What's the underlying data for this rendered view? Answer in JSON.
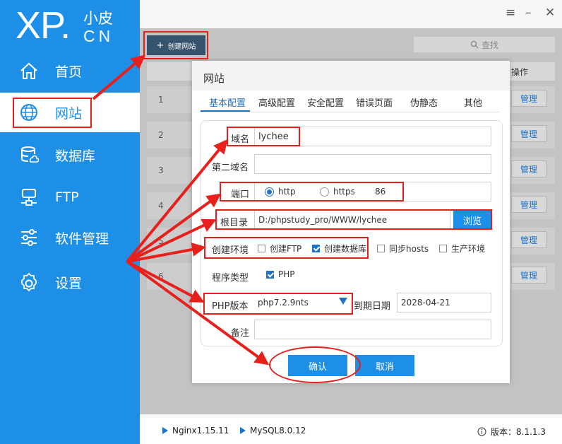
{
  "brand": {
    "xp": "XP.",
    "cn_top": "小皮",
    "cn_bottom": "CN"
  },
  "window_controls": {
    "menu": "≡",
    "minimize": "–",
    "close": "✕"
  },
  "sidebar": {
    "items": [
      {
        "label": "首页",
        "icon": "home-icon"
      },
      {
        "label": "网站",
        "icon": "globe-icon",
        "active": true
      },
      {
        "label": "数据库",
        "icon": "database-icon"
      },
      {
        "label": "FTP",
        "icon": "ftp-icon"
      },
      {
        "label": "软件管理",
        "icon": "sliders-icon"
      },
      {
        "label": "设置",
        "icon": "gear-icon"
      }
    ]
  },
  "toolbar": {
    "create_label": "创建网站",
    "search_placeholder": "查找"
  },
  "table": {
    "op_header": "操作",
    "rows": [
      {
        "num": "1",
        "action": "管理"
      },
      {
        "num": "2",
        "action": "管理"
      },
      {
        "num": "3",
        "action": "管理"
      },
      {
        "num": "4",
        "action": "管理"
      },
      {
        "num": "5",
        "action": "管理"
      },
      {
        "num": "6",
        "action": "管理"
      }
    ]
  },
  "dialog": {
    "title": "网站",
    "tabs": [
      "基本配置",
      "高级配置",
      "安全配置",
      "错误页面",
      "伪静态",
      "其他"
    ],
    "fields": {
      "domain_label": "域名",
      "domain_value": "lychee",
      "second_domain_label": "第二域名",
      "second_domain_value": "",
      "port_label": "端口",
      "http_label": "http",
      "https_label": "https",
      "port_value": "86",
      "root_label": "根目录",
      "root_value": "D:/phpstudy_pro/WWW/lychee",
      "browse_label": "浏览",
      "env_label": "创建环境",
      "env_ftp": "创建FTP",
      "env_db": "创建数据库",
      "env_hosts": "同步hosts",
      "env_prod": "生产环境",
      "program_label": "程序类型",
      "program_php": "PHP",
      "php_label": "PHP版本",
      "php_value": "php7.2.9nts",
      "expire_label": "到期日期",
      "expire_value": "2028-04-21",
      "note_label": "备注",
      "note_value": ""
    },
    "confirm_label": "确认",
    "cancel_label": "取消"
  },
  "status": {
    "nginx": "Nginx1.15.11",
    "mysql": "MySQL8.0.12",
    "version": "版本：8.1.1.3"
  },
  "colors": {
    "sidebar": "#1e8fe6",
    "accent": "#1e73c7",
    "annotation": "#e8201c"
  }
}
